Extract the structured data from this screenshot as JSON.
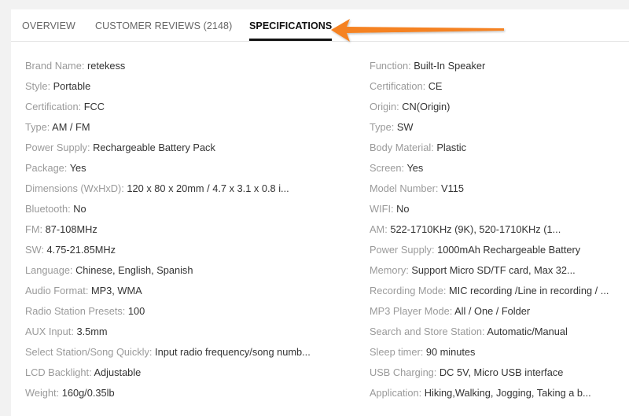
{
  "tabs": [
    {
      "label": "OVERVIEW",
      "active": false
    },
    {
      "label": "CUSTOMER REVIEWS (2148)",
      "active": false
    },
    {
      "label": "SPECIFICATIONS",
      "active": true
    }
  ],
  "annotation": {
    "type": "arrow",
    "color": "#f58220",
    "points_to": "SPECIFICATIONS"
  },
  "specs_left": [
    {
      "key": "Brand Name:",
      "value": "retekess"
    },
    {
      "key": "Style:",
      "value": "Portable"
    },
    {
      "key": "Certification:",
      "value": "FCC"
    },
    {
      "key": "Type:",
      "value": "AM / FM"
    },
    {
      "key": "Power Supply:",
      "value": "Rechargeable Battery Pack"
    },
    {
      "key": "Package:",
      "value": "Yes"
    },
    {
      "key": "Dimensions (WxHxD):",
      "value": "120 x 80 x 20mm / 4.7 x 3.1 x 0.8 i..."
    },
    {
      "key": "Bluetooth:",
      "value": "No"
    },
    {
      "key": "FM:",
      "value": "87-108MHz"
    },
    {
      "key": "SW:",
      "value": "4.75-21.85MHz"
    },
    {
      "key": "Language:",
      "value": "Chinese, English, Spanish"
    },
    {
      "key": "Audio Format:",
      "value": "MP3, WMA"
    },
    {
      "key": "Radio Station Presets:",
      "value": "100"
    },
    {
      "key": "AUX Input:",
      "value": "3.5mm"
    },
    {
      "key": "Select Station/Song Quickly:",
      "value": "Input radio frequency/song numb..."
    },
    {
      "key": "LCD Backlight:",
      "value": "Adjustable"
    },
    {
      "key": "Weight:",
      "value": "160g/0.35lb"
    }
  ],
  "specs_right": [
    {
      "key": "Function:",
      "value": "Built-In Speaker"
    },
    {
      "key": "Certification:",
      "value": "CE"
    },
    {
      "key": "Origin:",
      "value": "CN(Origin)"
    },
    {
      "key": "Type:",
      "value": "SW"
    },
    {
      "key": "Body Material:",
      "value": "Plastic"
    },
    {
      "key": "Screen:",
      "value": "Yes"
    },
    {
      "key": "Model Number:",
      "value": "V115"
    },
    {
      "key": "WIFI:",
      "value": "No"
    },
    {
      "key": "AM:",
      "value": "522-1710KHz (9K), 520-1710KHz (1..."
    },
    {
      "key": "Power Supply:",
      "value": "1000mAh Rechargeable Battery"
    },
    {
      "key": "Memory:",
      "value": "Support Micro SD/TF card, Max 32..."
    },
    {
      "key": "Recording Mode:",
      "value": "MIC recording /Line in recording / ..."
    },
    {
      "key": "MP3 Player Mode:",
      "value": "All / One / Folder"
    },
    {
      "key": "Search and Store Station:",
      "value": "Automatic/Manual"
    },
    {
      "key": "Sleep timer:",
      "value": "90 minutes"
    },
    {
      "key": "USB Charging:",
      "value": "DC 5V, Micro USB interface"
    },
    {
      "key": "Application:",
      "value": "Hiking,Walking, Jogging, Taking a b..."
    }
  ]
}
